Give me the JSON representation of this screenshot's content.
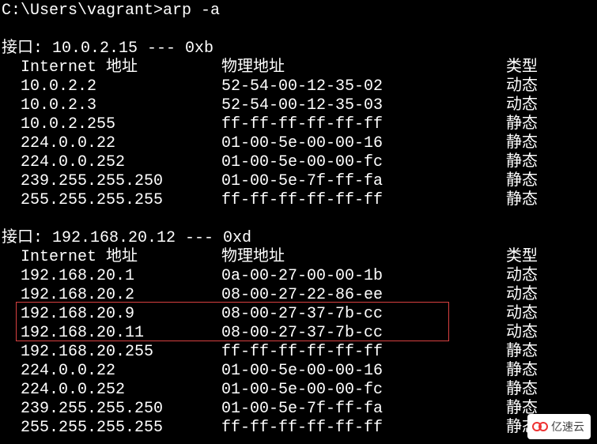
{
  "prompt": "C:\\Users\\vagrant>arp -a",
  "headers": {
    "ip": "Internet 地址",
    "mac": "物理地址",
    "type": "类型"
  },
  "interfaces": [
    {
      "header": "接口: 10.0.2.15 --- 0xb",
      "rows": [
        {
          "ip": "10.0.2.2",
          "mac": "52-54-00-12-35-02",
          "type": "动态",
          "hl": false
        },
        {
          "ip": "10.0.2.3",
          "mac": "52-54-00-12-35-03",
          "type": "动态",
          "hl": false
        },
        {
          "ip": "10.0.2.255",
          "mac": "ff-ff-ff-ff-ff-ff",
          "type": "静态",
          "hl": false
        },
        {
          "ip": "224.0.0.22",
          "mac": "01-00-5e-00-00-16",
          "type": "静态",
          "hl": false
        },
        {
          "ip": "224.0.0.252",
          "mac": "01-00-5e-00-00-fc",
          "type": "静态",
          "hl": false
        },
        {
          "ip": "239.255.255.250",
          "mac": "01-00-5e-7f-ff-fa",
          "type": "静态",
          "hl": false
        },
        {
          "ip": "255.255.255.255",
          "mac": "ff-ff-ff-ff-ff-ff",
          "type": "静态",
          "hl": false
        }
      ]
    },
    {
      "header": "接口: 192.168.20.12 --- 0xd",
      "rows": [
        {
          "ip": "192.168.20.1",
          "mac": "0a-00-27-00-00-1b",
          "type": "动态",
          "hl": false
        },
        {
          "ip": "192.168.20.2",
          "mac": "08-00-27-22-86-ee",
          "type": "动态",
          "hl": false
        },
        {
          "ip": "192.168.20.9",
          "mac": "08-00-27-37-7b-cc",
          "type": "动态",
          "hl": true
        },
        {
          "ip": "192.168.20.11",
          "mac": "08-00-27-37-7b-cc",
          "type": "动态",
          "hl": true
        },
        {
          "ip": "192.168.20.255",
          "mac": "ff-ff-ff-ff-ff-ff",
          "type": "静态",
          "hl": false
        },
        {
          "ip": "224.0.0.22",
          "mac": "01-00-5e-00-00-16",
          "type": "静态",
          "hl": false
        },
        {
          "ip": "224.0.0.252",
          "mac": "01-00-5e-00-00-fc",
          "type": "静态",
          "hl": false
        },
        {
          "ip": "239.255.255.250",
          "mac": "01-00-5e-7f-ff-fa",
          "type": "静态",
          "hl": false
        },
        {
          "ip": "255.255.255.255",
          "mac": "ff-ff-ff-ff-ff-ff",
          "type": "静态",
          "hl": false
        }
      ]
    }
  ],
  "watermark": "亿速云"
}
